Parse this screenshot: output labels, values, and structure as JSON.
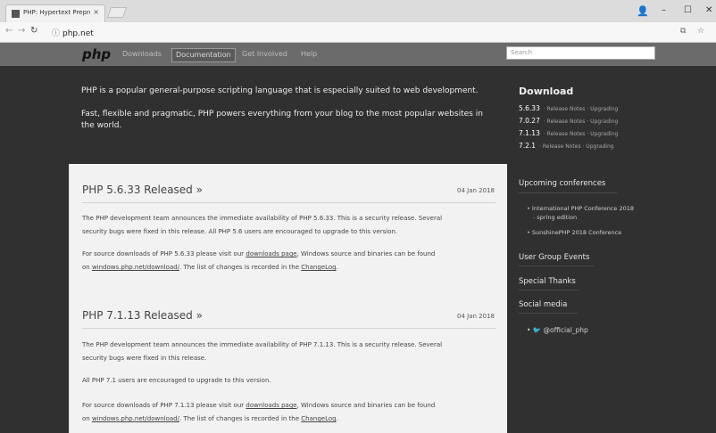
{
  "browser": {
    "tab_title": "PHP: Hypertext Preprocessor",
    "tab_close": "×",
    "url": "php.net",
    "window_controls": {
      "account": "👤",
      "minimize": "–",
      "maximize": "☐",
      "close": "✕"
    }
  },
  "site": {
    "logo": "php",
    "nav": [
      "Downloads",
      "Documentation",
      "Get Involved",
      "Help"
    ],
    "active_nav": "Documentation",
    "search_placeholder": "Search"
  },
  "intro": {
    "line1": "PHP is a popular general-purpose scripting language that is especially suited to web development.",
    "line2a": "Fast, flexible and pragmatic, PHP powers everything from your blog to the most popular websites in",
    "line2b": "the world."
  },
  "releases": [
    {
      "title": "PHP 5.6.33 Released »",
      "date": "04 Jan 2018",
      "p1a": "The PHP development team announces the immediate availability of PHP 5.6.33. This is a security release. Several",
      "p1b": "security bugs were fixed in this release. All PHP 5.6 users are encouraged to upgrade to this version.",
      "p2a_pre": "For source downloads of PHP 5.6.33 please visit our ",
      "p2a_link": "downloads page",
      "p2a_post": ", Windows source and binaries can be found",
      "p2b_pre": "on ",
      "p2b_link": "windows.php.net/download/",
      "p2b_mid": ". The list of changes is recorded in the ",
      "p2b_link2": "ChangeLog",
      "p2b_post": "."
    },
    {
      "title": "PHP 7.1.13 Released »",
      "date": "04 Jan 2018",
      "p1a": "The PHP development team announces the immediate availability of PHP 7.1.13. This is a security release. Several",
      "p1b": "security bugs were fixed in this release.",
      "p2": "All PHP 7.1 users are encouraged to upgrade to this version.",
      "p3a_pre": "For source downloads of PHP 7.1.13 please visit our ",
      "p3a_link": "downloads page",
      "p3a_post": ", Windows source and binaries can be found",
      "p3b_pre": "on ",
      "p3b_link": "windows.php.net/download/",
      "p3b_mid": ". The list of changes is recorded in the ",
      "p3b_link2": "ChangeLog",
      "p3b_post": "."
    }
  ],
  "sidebar": {
    "download_title": "Download",
    "downloads": [
      {
        "version": "5.6.33",
        "links": "· Release Notes · Upgrading"
      },
      {
        "version": "7.0.27",
        "links": "· Release Notes · Upgrading"
      },
      {
        "version": "7.1.13",
        "links": "· Release Notes · Upgrading"
      },
      {
        "version": "7.2.1",
        "links": "· Release Notes · Upgrading"
      }
    ],
    "conferences_title": "Upcoming conferences",
    "conferences": [
      {
        "line1": "International PHP Conference 2018",
        "line2": "- spring edition"
      },
      {
        "line1": "SunshinePHP 2018 Conference",
        "line2": ""
      }
    ],
    "user_group_events": "User Group Events",
    "special_thanks": "Special Thanks",
    "social_title": "Social media",
    "twitter": "@official_php"
  },
  "colors": {
    "navbar": "#6b6b6b",
    "main_bg": "#303030",
    "card_bg": "#f2f2f2",
    "chrome_tabs_bg": "#dcdcdc"
  }
}
